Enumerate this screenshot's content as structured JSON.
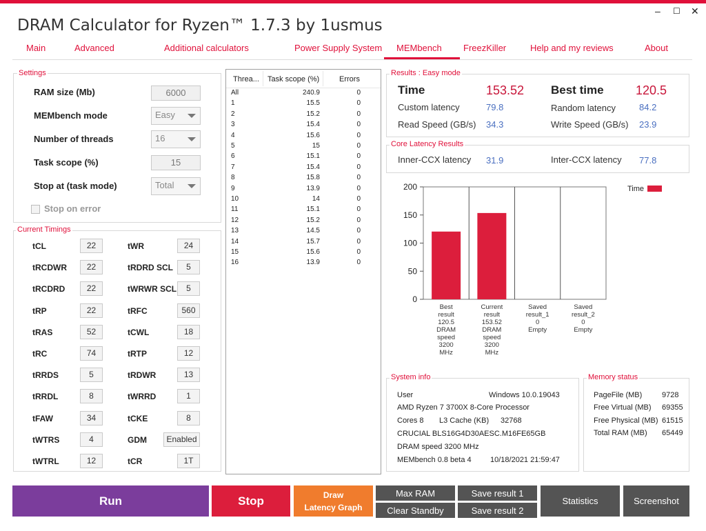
{
  "app": {
    "title": "DRAM Calculator for Ryzen™ 1.7.3 by 1usmus",
    "controls": {
      "minimize": "–",
      "maximize": "☐",
      "close": "✕"
    }
  },
  "tabs": [
    {
      "label": "Main"
    },
    {
      "label": "Advanced"
    },
    {
      "label": "Additional calculators"
    },
    {
      "label": "Power Supply System"
    },
    {
      "label": "MEMbench"
    },
    {
      "label": "FreezKiller"
    },
    {
      "label": "Help and my reviews"
    },
    {
      "label": "About"
    }
  ],
  "settings": {
    "title": "Settings",
    "ram_size_label": "RAM size (Mb)",
    "ram_size_value": "6000",
    "mode_label": "MEMbench mode",
    "mode_value": "Easy",
    "threads_label": "Number of threads",
    "threads_value": "16",
    "task_scope_label": "Task scope (%)",
    "task_scope_value": "15",
    "stop_at_label": "Stop at (task mode)",
    "stop_at_value": "Total",
    "stop_on_error_label": "Stop on error"
  },
  "timings": {
    "title": "Current Timings",
    "left": [
      {
        "label": "tCL",
        "value": "22"
      },
      {
        "label": "tRCDWR",
        "value": "22"
      },
      {
        "label": "tRCDRD",
        "value": "22"
      },
      {
        "label": "tRP",
        "value": "22"
      },
      {
        "label": "tRAS",
        "value": "52"
      },
      {
        "label": "tRC",
        "value": "74"
      },
      {
        "label": "tRRDS",
        "value": "5"
      },
      {
        "label": "tRRDL",
        "value": "8"
      },
      {
        "label": "tFAW",
        "value": "34"
      },
      {
        "label": "tWTRS",
        "value": "4"
      },
      {
        "label": "tWTRL",
        "value": "12"
      }
    ],
    "right": [
      {
        "label": "tWR",
        "value": "24"
      },
      {
        "label": "tRDRD SCL",
        "value": "5"
      },
      {
        "label": "tWRWR SCL",
        "value": "5"
      },
      {
        "label": "tRFC",
        "value": "560"
      },
      {
        "label": "tCWL",
        "value": "18"
      },
      {
        "label": "tRTP",
        "value": "12"
      },
      {
        "label": "tRDWR",
        "value": "13"
      },
      {
        "label": "tWRRD",
        "value": "1"
      },
      {
        "label": "tCKE",
        "value": "8"
      },
      {
        "label": "GDM",
        "value": "Enabled"
      },
      {
        "label": "tCR",
        "value": "1T"
      }
    ]
  },
  "threads_table": {
    "headers": [
      "Threa...",
      "Task scope (%)",
      "Errors"
    ],
    "rows": [
      [
        "All",
        "240.9",
        "0"
      ],
      [
        "1",
        "15.5",
        "0"
      ],
      [
        "2",
        "15.2",
        "0"
      ],
      [
        "3",
        "15.4",
        "0"
      ],
      [
        "4",
        "15.6",
        "0"
      ],
      [
        "5",
        "15",
        "0"
      ],
      [
        "6",
        "15.1",
        "0"
      ],
      [
        "7",
        "15.4",
        "0"
      ],
      [
        "8",
        "15.8",
        "0"
      ],
      [
        "9",
        "13.9",
        "0"
      ],
      [
        "10",
        "14",
        "0"
      ],
      [
        "11",
        "15.1",
        "0"
      ],
      [
        "12",
        "15.2",
        "0"
      ],
      [
        "13",
        "14.5",
        "0"
      ],
      [
        "14",
        "15.7",
        "0"
      ],
      [
        "15",
        "15.6",
        "0"
      ],
      [
        "16",
        "13.9",
        "0"
      ]
    ]
  },
  "results": {
    "title": "Results : Easy mode",
    "time_label": "Time",
    "time_value": "153.52",
    "best_time_label": "Best time",
    "best_time_value": "120.5",
    "custom_latency_label": "Custom latency",
    "custom_latency_value": "79.8",
    "random_latency_label": "Random latency",
    "random_latency_value": "84.2",
    "read_speed_label": "Read Speed (GB/s)",
    "read_speed_value": "34.3",
    "write_speed_label": "Write Speed (GB/s)",
    "write_speed_value": "23.9"
  },
  "core_latency": {
    "title": "Core Latency Results",
    "inner_label": "Inner-CCX latency",
    "inner_value": "31.9",
    "inter_label": "Inter-CCX latency",
    "inter_value": "77.8"
  },
  "chart_data": {
    "type": "bar",
    "ylim": [
      0,
      200
    ],
    "yticks": [
      0,
      50,
      100,
      150,
      200
    ],
    "legend": "Time",
    "color": "#dc1e3c",
    "categories": [
      {
        "lines": [
          "Best",
          "result",
          "120.5",
          "DRAM",
          "speed",
          "3200",
          "MHz"
        ],
        "value": 120.5
      },
      {
        "lines": [
          "Current",
          "result",
          "153.52",
          "DRAM",
          "speed",
          "3200",
          "MHz"
        ],
        "value": 153.52
      },
      {
        "lines": [
          "Saved",
          "result_1",
          "0",
          "Empty"
        ],
        "value": 0
      },
      {
        "lines": [
          "Saved",
          "result_2",
          "0",
          "Empty"
        ],
        "value": 0
      }
    ]
  },
  "system_info": {
    "title": "System info",
    "user_label": "User",
    "os": "Windows 10.0.19043",
    "cpu": "AMD Ryzen 7 3700X 8-Core Processor",
    "cores": "Cores 8",
    "l3_label": "L3 Cache (KB)",
    "l3_value": "32768",
    "memory": "CRUCIAL BLS16G4D30AESC.M16FE65GB",
    "dram_speed": "DRAM speed 3200 MHz",
    "membench": "MEMbench 0.8 beta 4",
    "datetime": "10/18/2021 21:59:47"
  },
  "memory_status": {
    "title": "Memory status",
    "items": [
      {
        "label": "PageFile (MB)",
        "value": "9728"
      },
      {
        "label": "Free Virtual (MB)",
        "value": "69355"
      },
      {
        "label": "Free Physical (MB)",
        "value": "61515"
      },
      {
        "label": "Total RAM (MB)",
        "value": "65449"
      }
    ]
  },
  "buttons": {
    "run": "Run",
    "stop": "Stop",
    "draw_latency_1": "Draw",
    "draw_latency_2": "Latency Graph",
    "max_ram": "Max RAM",
    "clear_standby": "Clear Standby",
    "save1": "Save result 1",
    "save2": "Save result 2",
    "statistics": "Statistics",
    "screenshot": "Screenshot"
  },
  "colors": {
    "accent": "#e0103a",
    "run": "#7b3d9c",
    "stop": "#dc1e3c",
    "draw": "#f07c2d",
    "gray": "#545454",
    "value_blue": "#4a6fc0"
  }
}
